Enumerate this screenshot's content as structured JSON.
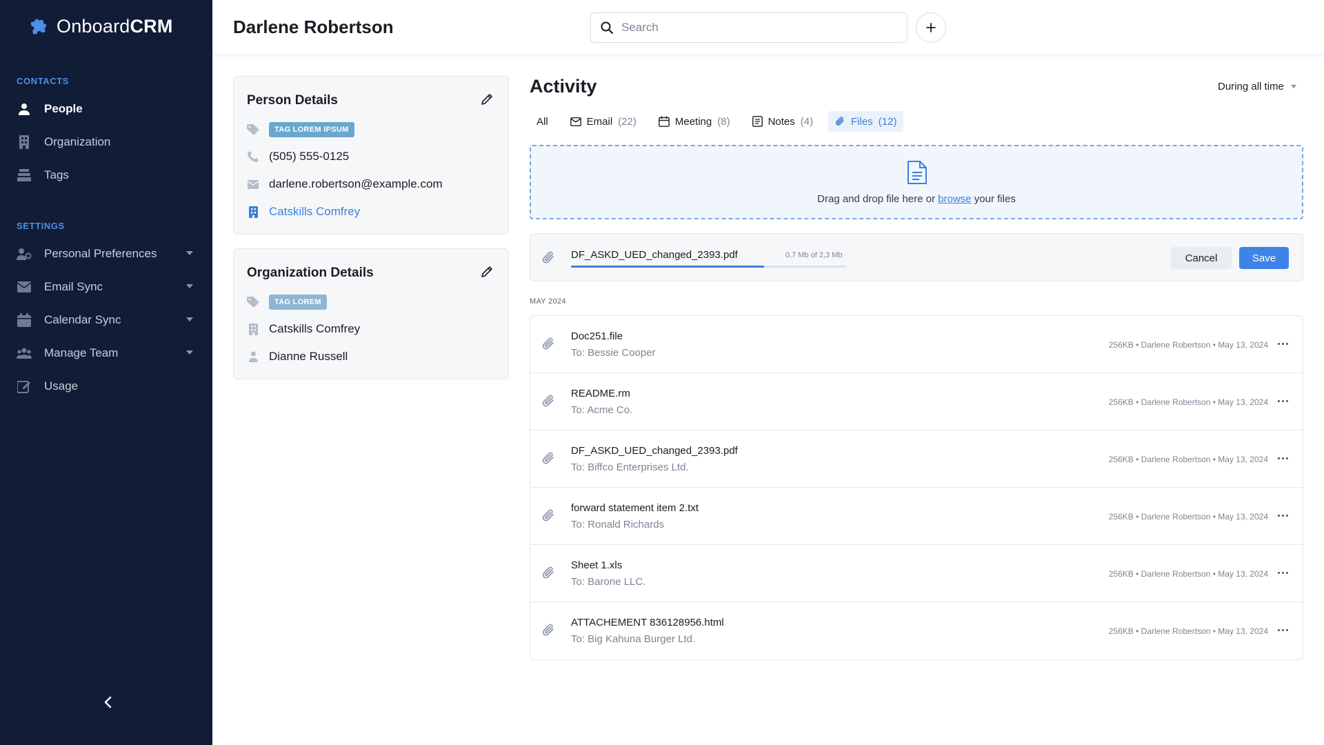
{
  "app": {
    "name_light": "Onboard",
    "name_bold": "CRM"
  },
  "sidebar": {
    "contacts_label": "CONTACTS",
    "contacts": [
      {
        "label": "People",
        "icon": "person-icon",
        "active": true
      },
      {
        "label": "Organization",
        "icon": "building-icon"
      },
      {
        "label": "Tags",
        "icon": "tags-icon"
      }
    ],
    "settings_label": "SETTINGS",
    "settings": [
      {
        "label": "Personal Preferences",
        "icon": "user-settings-icon"
      },
      {
        "label": "Email Sync",
        "icon": "envelope-icon"
      },
      {
        "label": "Calendar Sync",
        "icon": "calendar-icon"
      },
      {
        "label": "Manage Team",
        "icon": "team-icon"
      },
      {
        "label": "Usage",
        "icon": "edit-icon"
      }
    ]
  },
  "header": {
    "title": "Darlene Robertson",
    "search_placeholder": "Search"
  },
  "person": {
    "title": "Person Details",
    "tag": "TAG LOREM IPSUM",
    "phone": "(505) 555-0125",
    "email": "darlene.robertson@example.com",
    "organization": "Catskills Comfrey"
  },
  "org": {
    "title": "Organization Details",
    "tag": "TAG LOREM",
    "name": "Catskills Comfrey",
    "contact": "Dianne Russell"
  },
  "activity": {
    "title": "Activity",
    "period": "During all time",
    "tabs": [
      {
        "label": "All",
        "count": ""
      },
      {
        "label": "Email",
        "count": "(22)"
      },
      {
        "label": "Meeting",
        "count": "(8)"
      },
      {
        "label": "Notes",
        "count": "(4)"
      },
      {
        "label": "Files",
        "count": "(12)"
      }
    ],
    "dropzone": {
      "before": "Drag and drop file here or",
      "link": "browse",
      "after": "your files"
    },
    "upload": {
      "filename": "DF_ASKD_UED_changed_2393.pdf",
      "size": "0,7 Mb of 2,3 Mb",
      "progress": 0.7,
      "cancel": "Cancel",
      "save": "Save"
    },
    "month": "MAY 2024",
    "files": [
      {
        "name": "Doc251.file",
        "to": "To: Bessie Cooper",
        "meta": "256KB • Darlene Robertson • May 13, 2024"
      },
      {
        "name": "README.rm",
        "to": "To: Acme Co.",
        "meta": "256KB • Darlene Robertson • May 13, 2024"
      },
      {
        "name": "DF_ASKD_UED_changed_2393.pdf",
        "to": "To: Biffco Enterprises Ltd.",
        "meta": "256KB • Darlene Robertson • May 13, 2024"
      },
      {
        "name": "forward statement item 2.txt",
        "to": "To: Ronald Richards",
        "meta": "256KB • Darlene Robertson • May 13, 2024"
      },
      {
        "name": "Sheet 1.xls",
        "to": "To: Barone LLC.",
        "meta": "256KB • Darlene Robertson • May 13, 2024"
      },
      {
        "name": "ATTACHEMENT 836128956.html",
        "to": "To: Big Kahuna Burger Ltd.",
        "meta": "256KB • Darlene Robertson • May 13, 2024"
      }
    ]
  },
  "colors": {
    "sidebar_bg": "#111c36",
    "accent": "#3d7fd9",
    "tag": "#6aa7cf"
  }
}
